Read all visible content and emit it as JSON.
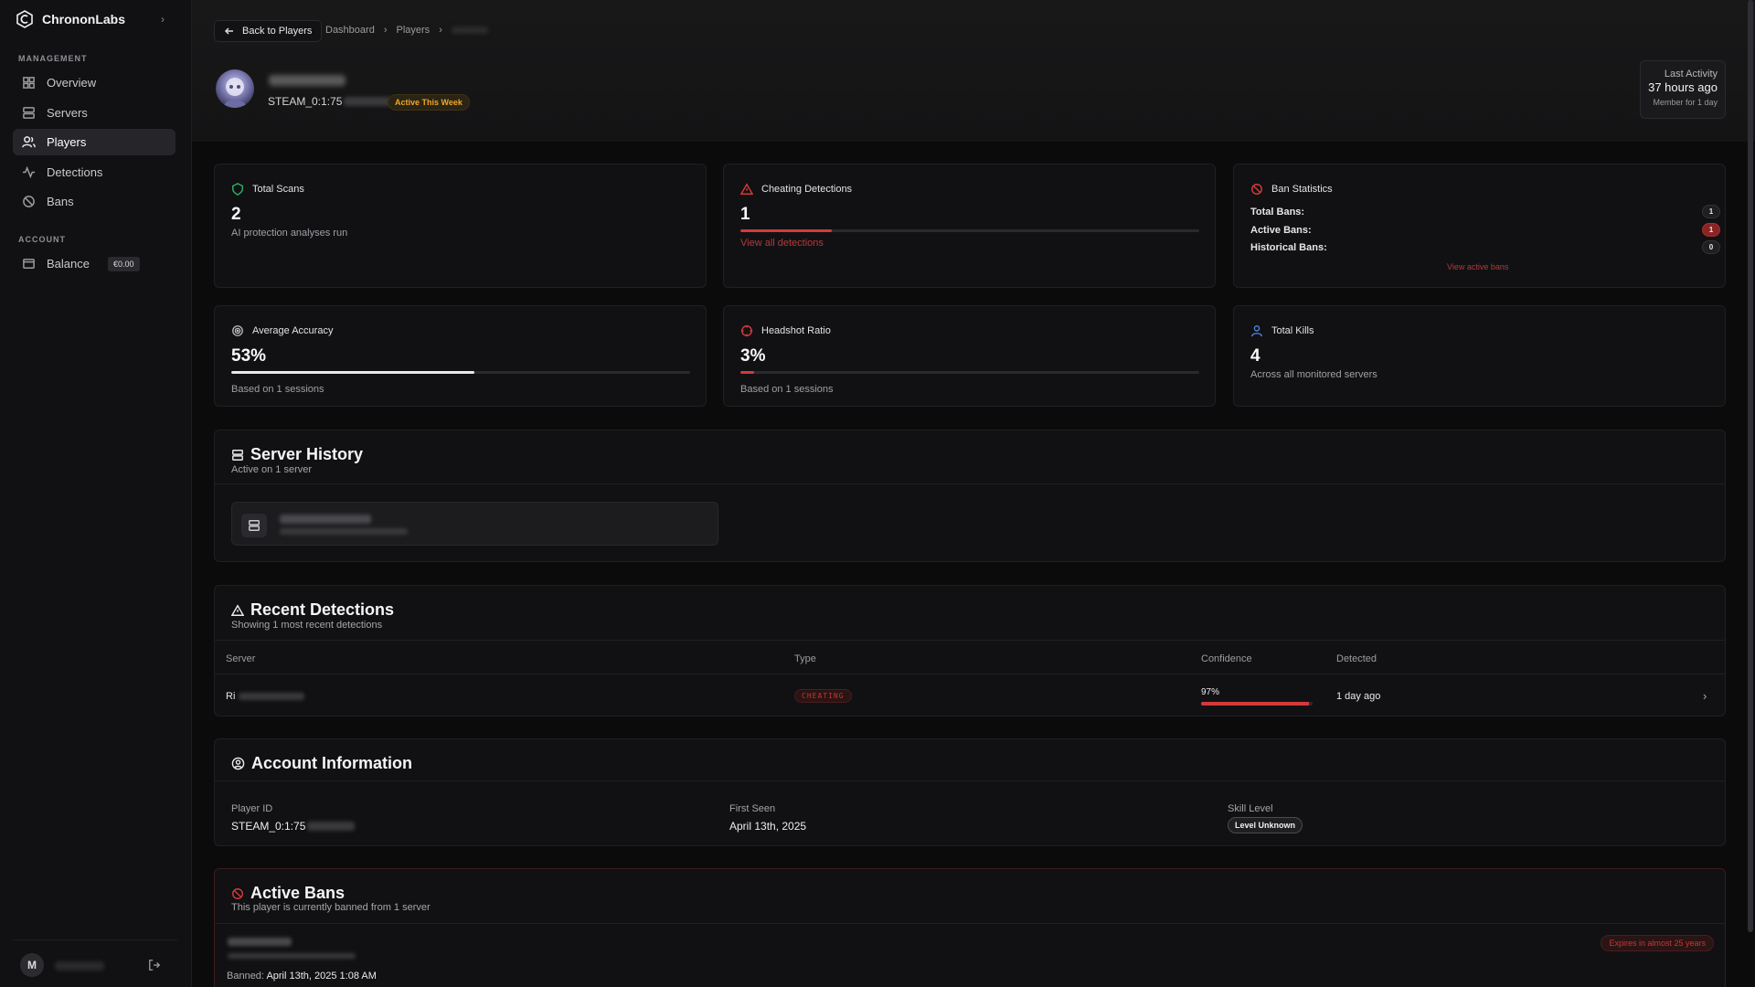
{
  "app": {
    "name": "ChrononLabs"
  },
  "sidebar": {
    "management_label": "MANAGEMENT",
    "account_label": "ACCOUNT",
    "items": [
      {
        "label": "Overview",
        "icon": "grid-icon"
      },
      {
        "label": "Servers",
        "icon": "server-icon"
      },
      {
        "label": "Players",
        "icon": "users-icon",
        "active": true
      },
      {
        "label": "Detections",
        "icon": "activity-icon"
      },
      {
        "label": "Bans",
        "icon": "ban-icon"
      }
    ],
    "balance": {
      "label": "Balance",
      "value": "€0.00"
    },
    "user_initial": "M"
  },
  "header": {
    "back_label": "Back to Players",
    "breadcrumbs": [
      "Dashboard",
      "Players"
    ],
    "steam_id_prefix": "STEAM_0:1:75",
    "activity_badge": "Active This Week",
    "last_activity_label": "Last Activity",
    "last_activity_value": "37 hours ago",
    "member_for": "Member for 1 day"
  },
  "stats": {
    "total_scans": {
      "title": "Total Scans",
      "value": "2",
      "sub": "AI protection analyses run"
    },
    "cheating": {
      "title": "Cheating Detections",
      "value": "1",
      "link": "View all detections",
      "bar_fraction": 0.2
    },
    "ban_stats": {
      "title": "Ban Statistics",
      "total_label": "Total Bans:",
      "total": "1",
      "active_label": "Active Bans:",
      "active": "1",
      "historical_label": "Historical Bans:",
      "historical": "0",
      "link": "View active bans"
    },
    "accuracy": {
      "title": "Average Accuracy",
      "value": "53%",
      "sub": "Based on 1 sessions",
      "bar_fraction": 0.53
    },
    "headshot": {
      "title": "Headshot Ratio",
      "value": "3%",
      "sub": "Based on 1 sessions",
      "bar_fraction": 0.03
    },
    "kills": {
      "title": "Total Kills",
      "value": "4",
      "sub": "Across all monitored servers"
    }
  },
  "server_history": {
    "title": "Server History",
    "sub": "Active on 1 server"
  },
  "recent_detections": {
    "title": "Recent Detections",
    "sub": "Showing 1 most recent detections",
    "columns": [
      "Server",
      "Type",
      "Confidence",
      "Detected"
    ],
    "rows": [
      {
        "server_prefix": "Ri",
        "type": "CHEATING",
        "confidence": "97%",
        "confidence_fraction": 0.97,
        "detected": "1 day ago"
      }
    ]
  },
  "account_info": {
    "title": "Account Information",
    "player_id_label": "Player ID",
    "player_id_prefix": "STEAM_0:1:75",
    "first_seen_label": "First Seen",
    "first_seen": "April 13th, 2025",
    "skill_label": "Skill Level",
    "skill_value": "Level Unknown"
  },
  "active_bans": {
    "title": "Active Bans",
    "sub": "This player is currently banned from 1 server",
    "expires": "Expires in almost 25 years",
    "banned_label": "Banned:",
    "banned_value": "April 13th, 2025 1:08 AM"
  }
}
